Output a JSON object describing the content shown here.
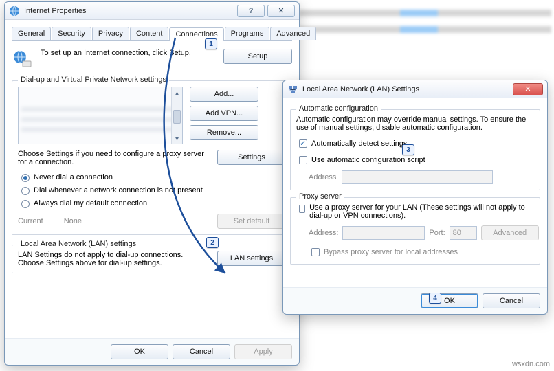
{
  "watermark": "wsxdn.com",
  "internet_properties": {
    "title": "Internet Properties",
    "tabs": [
      "General",
      "Security",
      "Privacy",
      "Content",
      "Connections",
      "Programs",
      "Advanced"
    ],
    "active_tab_index": 4,
    "setup_text": "To set up an Internet connection, click Setup.",
    "buttons": {
      "setup": "Setup",
      "add": "Add...",
      "add_vpn": "Add VPN...",
      "remove": "Remove...",
      "settings": "Settings",
      "set_default": "Set default",
      "lan_settings": "LAN settings",
      "ok": "OK",
      "cancel": "Cancel",
      "apply": "Apply"
    },
    "group_dialup_title": "Dial-up and Virtual Private Network settings",
    "choose_text": "Choose Settings if you need to configure a proxy server for a connection.",
    "radios": {
      "never": "Never dial a connection",
      "whenever": "Dial whenever a network connection is not present",
      "always": "Always dial my default connection"
    },
    "current_label": "Current",
    "current_value": "None",
    "group_lan_title": "Local Area Network (LAN) settings",
    "lan_note": "LAN Settings do not apply to dial-up connections. Choose Settings above for dial-up settings."
  },
  "lan_dialog": {
    "title": "Local Area Network (LAN) Settings",
    "group_auto_title": "Automatic configuration",
    "auto_note": "Automatic configuration may override manual settings.  To ensure the use of manual settings, disable automatic configuration.",
    "chk_auto_detect": "Automatically detect settings",
    "chk_auto_detect_checked": true,
    "chk_use_script": "Use automatic configuration script",
    "chk_use_script_checked": false,
    "address_label": "Address",
    "group_proxy_title": "Proxy server",
    "chk_use_proxy": "Use a proxy server for your LAN (These settings will not apply to dial-up or VPN connections).",
    "chk_use_proxy_checked": false,
    "proxy_address_label": "Address:",
    "proxy_port_label": "Port:",
    "proxy_port_value": "80",
    "advanced": "Advanced",
    "chk_bypass": "Bypass proxy server for local addresses",
    "chk_bypass_checked": false,
    "ok": "OK",
    "cancel": "Cancel"
  },
  "markers": {
    "m1": "1",
    "m2": "2",
    "m3": "3",
    "m4": "4"
  }
}
